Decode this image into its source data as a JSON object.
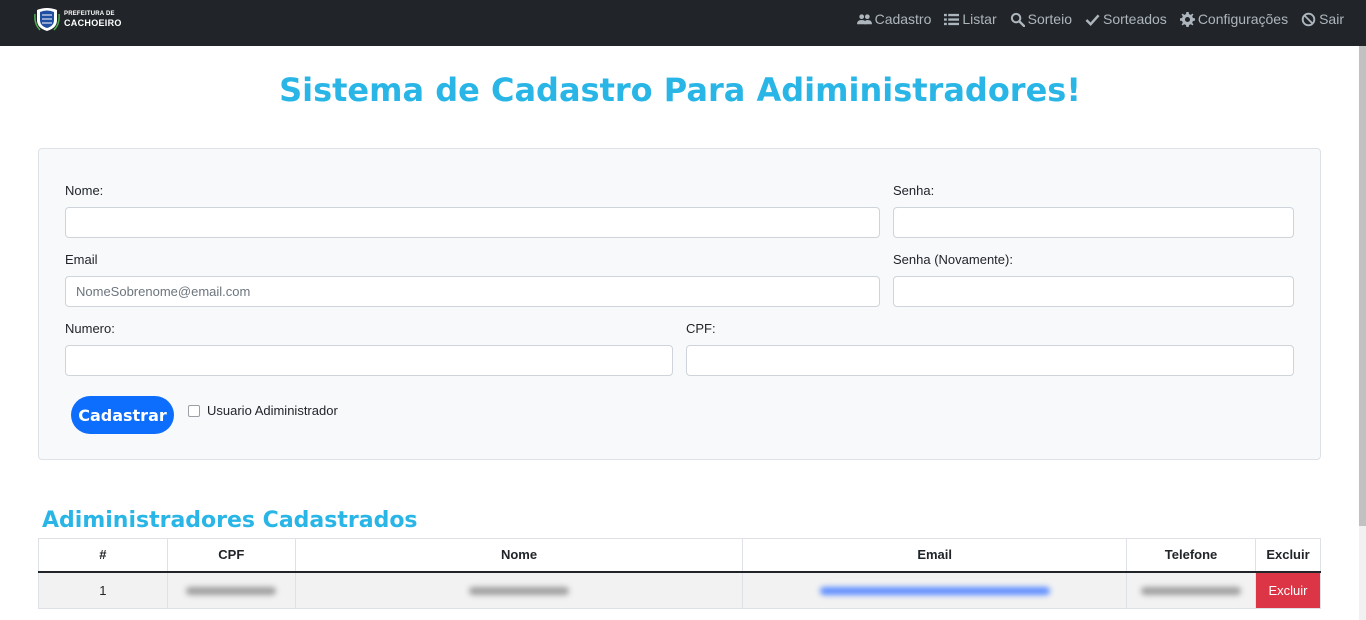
{
  "header": {
    "logo_line1": "PREFEITURA DE",
    "logo_line2": "CACHOEIRO",
    "nav": [
      {
        "label": "Cadastro",
        "icon": "users-icon"
      },
      {
        "label": "Listar",
        "icon": "list-icon"
      },
      {
        "label": "Sorteio",
        "icon": "search-icon"
      },
      {
        "label": "Sorteados",
        "icon": "check-icon"
      },
      {
        "label": "Configurações",
        "icon": "gear-icon"
      },
      {
        "label": "Sair",
        "icon": "ban-icon"
      }
    ]
  },
  "page_title": "Sistema de Cadastro Para Adiministradores!",
  "form": {
    "nome_label": "Nome:",
    "nome_value": "",
    "senha_label": "Senha:",
    "senha_value": "",
    "email_label": "Email",
    "email_placeholder": "NomeSobrenome@email.com",
    "senha2_label": "Senha (Novamente):",
    "senha2_value": "",
    "numero_label": "Numero:",
    "numero_value": "",
    "cpf_label": "CPF:",
    "cpf_value": "",
    "submit_label": "Cadastrar",
    "admin_checkbox_label": "Usuario Adiministrador",
    "admin_checked": false
  },
  "table": {
    "title": "Adiministradores Cadastrados",
    "headers": [
      "#",
      "CPF",
      "Nome",
      "Email",
      "Telefone",
      "Excluir"
    ],
    "rows": [
      {
        "index": "1",
        "delete_label": "Excluir"
      }
    ]
  },
  "colors": {
    "accent": "#29b6e6",
    "primary": "#0d6efd",
    "danger": "#dc3545",
    "navbar": "#212529"
  }
}
